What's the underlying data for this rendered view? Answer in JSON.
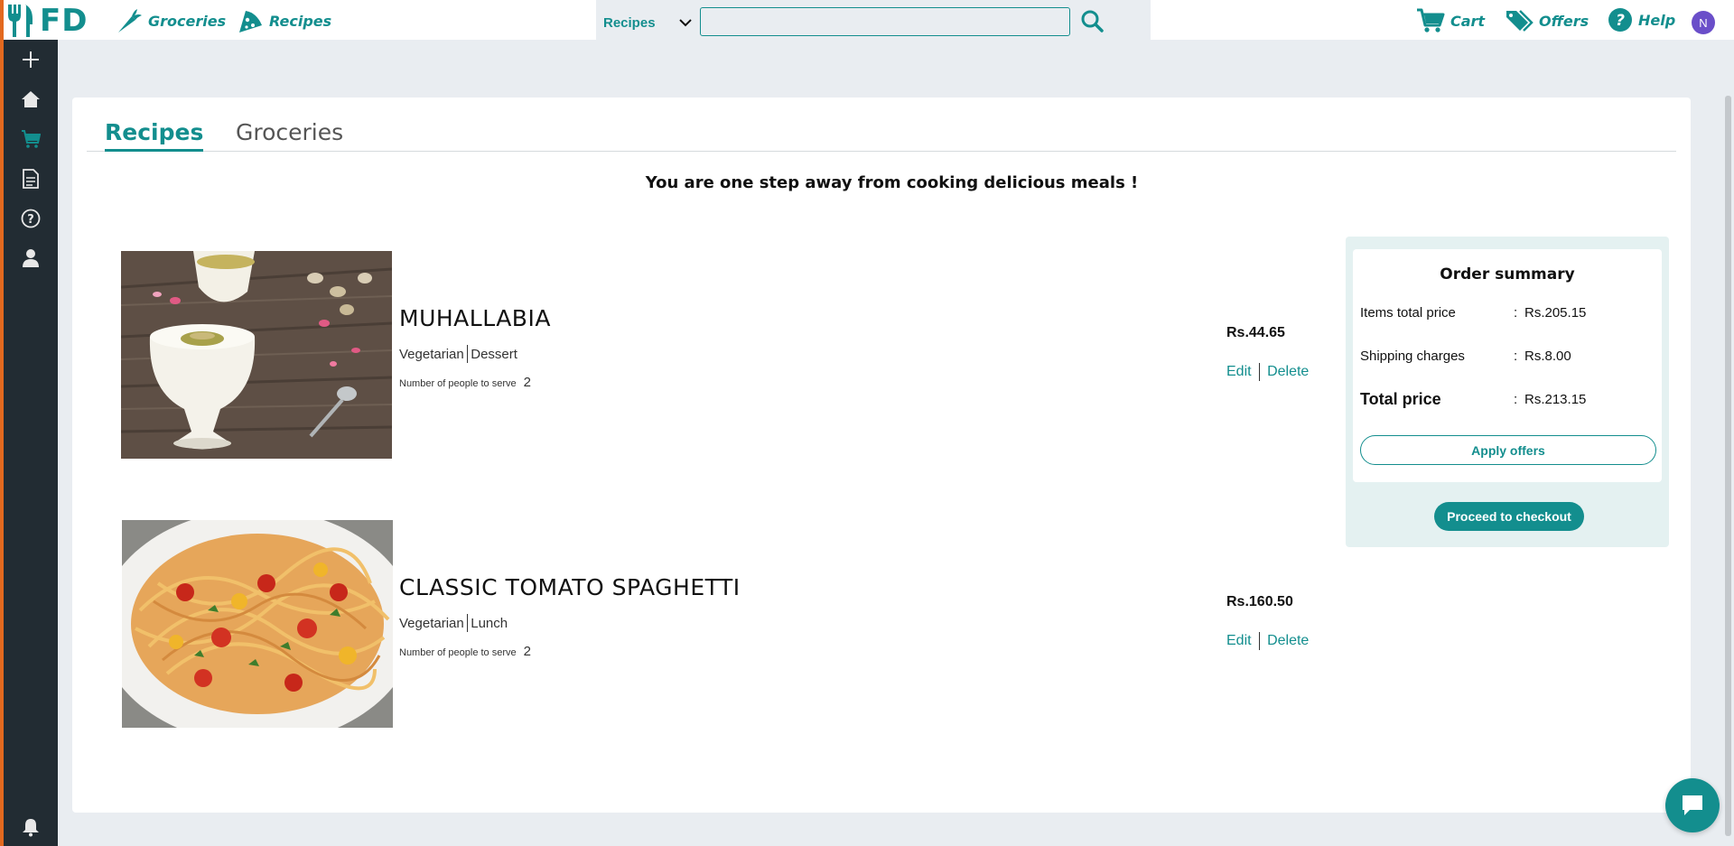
{
  "brand": {
    "logo_text": "FD",
    "accent_color": "#138e8e",
    "sidebar_color": "#222c33"
  },
  "nav": {
    "groceries_label": "Groceries",
    "recipes_label": "Recipes",
    "cart_label": "Cart",
    "offers_label": "Offers",
    "help_label": "Help",
    "avatar_initial": "N"
  },
  "search": {
    "category_selected": "Recipes",
    "placeholder": "",
    "value": ""
  },
  "sidebar": {
    "icons": [
      "plus-icon",
      "home-icon",
      "cart-icon",
      "document-icon",
      "help-icon",
      "user-icon",
      "bell-icon"
    ],
    "active": "cart-icon"
  },
  "tabs": [
    {
      "label": "Recipes",
      "active": true
    },
    {
      "label": "Groceries",
      "active": false
    }
  ],
  "headline": "You are one step away from cooking delicious meals !",
  "items": [
    {
      "name": "MUHALLABIA",
      "tag1": "Vegetarian",
      "tag2": "Dessert",
      "serve_label": "Number of people to serve",
      "serve_count": "2",
      "price": "Rs.44.65",
      "edit_label": "Edit",
      "delete_label": "Delete"
    },
    {
      "name": "CLASSIC TOMATO SPAGHETTI",
      "tag1": "Vegetarian",
      "tag2": "Lunch",
      "serve_label": "Number of people to serve",
      "serve_count": "2",
      "price": "Rs.160.50",
      "edit_label": "Edit",
      "delete_label": "Delete"
    }
  ],
  "summary": {
    "title": "Order summary",
    "items_total_label": "Items total price",
    "items_total_value": "Rs.205.15",
    "shipping_label": "Shipping charges",
    "shipping_value": "Rs.8.00",
    "total_label": "Total price",
    "total_value": "Rs.213.15",
    "colon": ":",
    "apply_offers_label": "Apply offers",
    "checkout_label": "Proceed to checkout"
  }
}
